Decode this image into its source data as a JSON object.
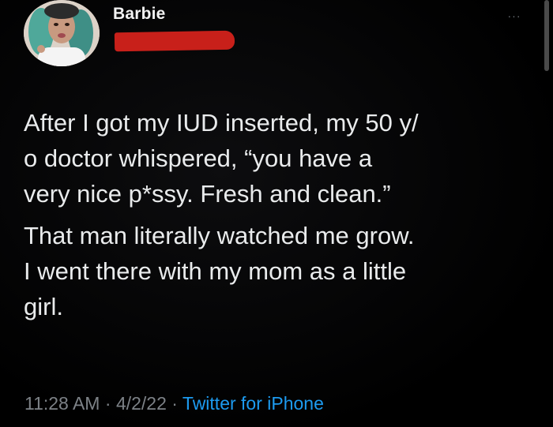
{
  "tweet": {
    "author": {
      "display_name": "Barbie",
      "avatar_icon": "profile-photo-avatar",
      "handle_redacted_color": "#c8201a"
    },
    "more_icon": "ellipsis-icon",
    "more_label": "···",
    "paragraphs": [
      "After I got my IUD inserted, my 50 y/\no doctor whispered, “you have a\nvery nice p*ssy. Fresh and clean.”",
      "That man literally watched me grow.\nI went there with my mom as a little\ngirl."
    ],
    "time": "11:28 AM",
    "separator": " · ",
    "date": "4/2/22",
    "source": "Twitter for iPhone"
  },
  "colors": {
    "background": "#000000",
    "text": "#e9ebec",
    "meta": "#7d8287",
    "link": "#1d9bf0"
  }
}
